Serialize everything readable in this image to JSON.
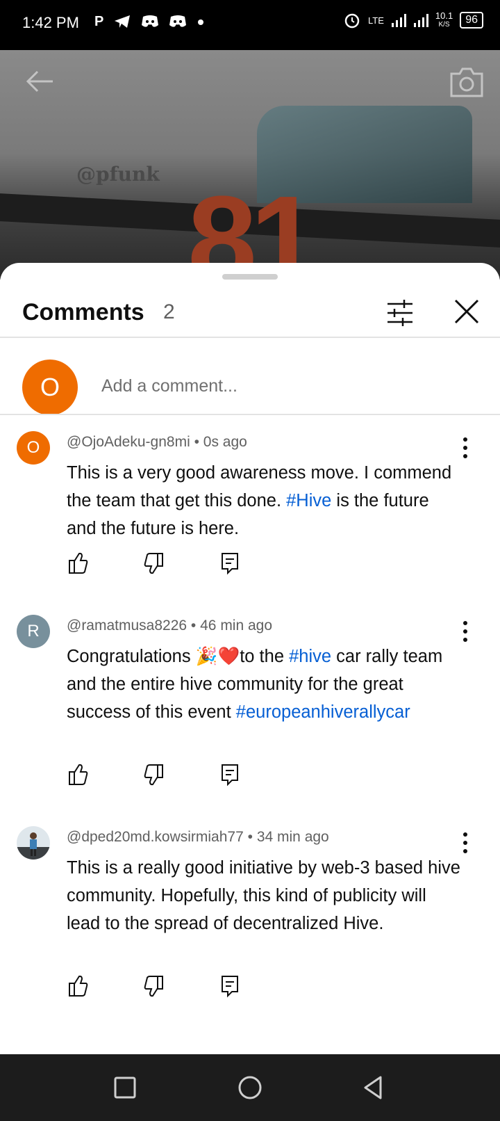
{
  "status_bar": {
    "time": "1:42 PM",
    "left_icons": [
      "P",
      "telegram-icon",
      "discord-icon",
      "discord-icon",
      "dot-icon"
    ],
    "network": "LTE",
    "speed_value": "10.1",
    "speed_unit": "K/S",
    "battery": "96"
  },
  "video_preview": {
    "watermark_text": "@pfunk",
    "car_number": "81"
  },
  "comments_sheet": {
    "title": "Comments",
    "count": "2",
    "add_comment": {
      "avatar_letter": "O",
      "placeholder": "Add a comment..."
    },
    "comments": [
      {
        "author": "@OjoAdeku-gn8mi",
        "time": "0s ago",
        "avatar_letter": "O",
        "avatar_color": "#ef6c00",
        "text_parts": [
          "This is a very good awareness move. I commend the team that get this done. ",
          "#Hive",
          " is the future and the future is here."
        ]
      },
      {
        "author": "@ramatmusa8226",
        "time": "46 min ago",
        "avatar_letter": "R",
        "avatar_color": "#78909c",
        "text_parts": [
          "Congratulations 🎉❤️to the ",
          "#hive",
          " car rally team and the entire hive community for the great success of this event ",
          "#europeanhiverallycar"
        ]
      },
      {
        "author": "@dped20md.kowsirmiah77",
        "time": "34 min ago",
        "avatar_letter": "",
        "avatar_color": "#6b7f8a",
        "text_parts": [
          "This is a really good initiative by web-3 based hive community.  Hopefully, this kind of publicity will lead to the spread of decentralized Hive."
        ]
      }
    ],
    "meta_separator": "•"
  },
  "colors": {
    "hashtag": "#065fd4",
    "primary_text": "#0f0f0f",
    "secondary_text": "#606060"
  }
}
